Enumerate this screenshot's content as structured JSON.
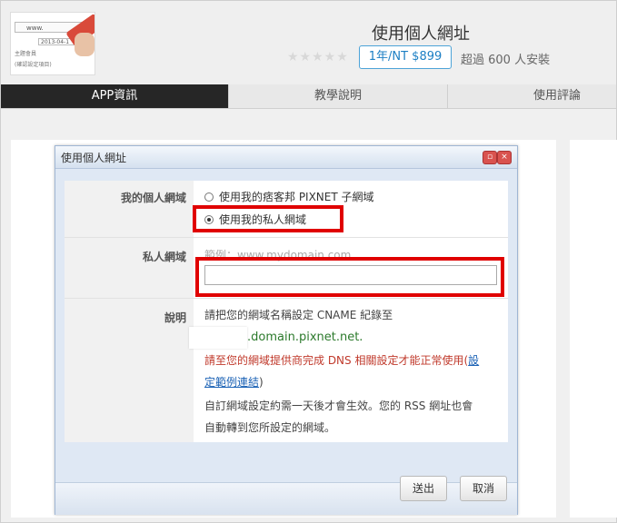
{
  "app": {
    "title": "使用個人網址",
    "stars": "★★★★★",
    "price": "1年/NT $899",
    "installs": "超過 600 人安裝",
    "thumbnail": {
      "url_text": "www.",
      "date_text": "2013-04-1",
      "btn_text": "(確認設定項目)",
      "row1": "主題會員",
      "row2": "加入設定區"
    }
  },
  "tabs": [
    {
      "label": "APP資訊",
      "active": true
    },
    {
      "label": "教學說明",
      "active": false
    },
    {
      "label": "使用評論",
      "active": false
    }
  ],
  "dialog": {
    "title": "使用個人網址",
    "rows": {
      "domain_label": "我的個人網域",
      "option_pixnet": "使用我的痞客邦 PIXNET 子網域",
      "option_private": "使用我的私人網域",
      "private_label": "私人網域",
      "private_placeholder": "範例：www.mydomain.com",
      "private_value": "",
      "desc_label": "說明",
      "desc_line1": "請把您的網域名稱設定 CNAME 紀錄至",
      "desc_cname": ".domain.pixnet.net.",
      "desc_warn": "請至您的網域提供商完成 DNS 相關設定才能正常使用(",
      "desc_link_a": "設",
      "desc_link_b": "定範例連結",
      "desc_close": ")",
      "desc_line3": "自訂網域設定約需一天後才會生效。您的 RSS 網址也會",
      "desc_line4": "自動轉到您所設定的網域。"
    },
    "buttons": {
      "submit": "送出",
      "cancel": "取消"
    },
    "selected_option": "private"
  },
  "colors": {
    "highlight": "#e00000",
    "link": "#1b62b5",
    "warning": "#c0392b",
    "cname": "#2c7a2c"
  }
}
